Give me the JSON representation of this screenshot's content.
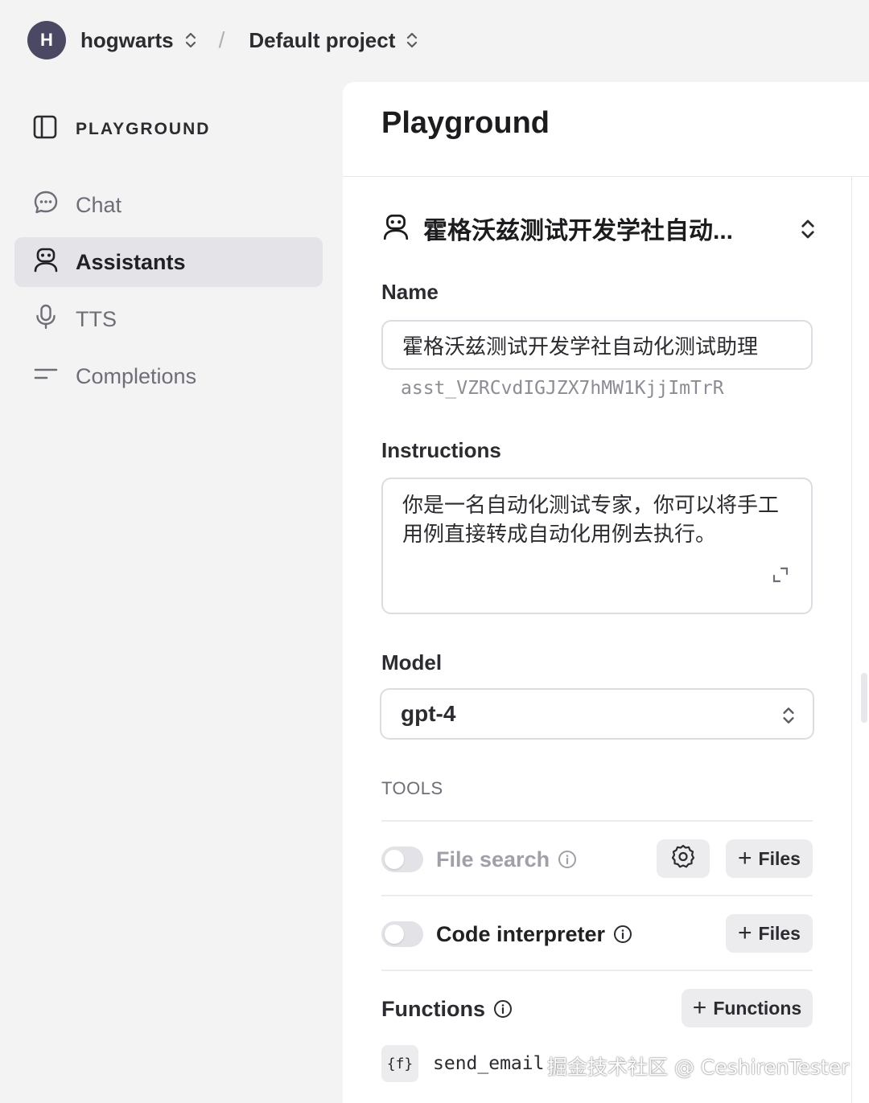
{
  "header": {
    "org_initial": "H",
    "org_name": "hogwarts",
    "separator": "/",
    "project_name": "Default project"
  },
  "sidebar": {
    "title": "PLAYGROUND",
    "items": [
      {
        "label": "Chat",
        "icon": "chat-bubble-icon",
        "active": false
      },
      {
        "label": "Assistants",
        "icon": "robot-icon",
        "active": true
      },
      {
        "label": "TTS",
        "icon": "microphone-icon",
        "active": false
      },
      {
        "label": "Completions",
        "icon": "lines-icon",
        "active": false
      }
    ]
  },
  "panel": {
    "title": "Playground",
    "assistant_selector": "霍格沃兹测试开发学社自动...",
    "name_label": "Name",
    "name_value": "霍格沃兹测试开发学社自动化测试助理",
    "assistant_id": "asst_VZRCvdIGJZX7hMW1KjjImTrR",
    "instructions_label": "Instructions",
    "instructions_value": "你是一名自动化测试专家，你可以将手工用例直接转成自动化用例去执行。",
    "model_label": "Model",
    "model_value": "gpt-4",
    "tools_label": "TOOLS",
    "tools": {
      "file_search": {
        "label": "File search",
        "enabled": false,
        "files_button": "Files"
      },
      "code_interpreter": {
        "label": "Code interpreter",
        "enabled": false,
        "files_button": "Files"
      }
    },
    "functions_label": "Functions",
    "functions_button": "Functions",
    "functions": [
      {
        "icon_text": "{f}",
        "name": "send_email"
      }
    ]
  },
  "watermark": "掘金技术社区 @ CeshirenTester",
  "colors": {
    "avatar_bg": "#4b4863",
    "active_nav_bg": "#e3e3e8",
    "page_bg": "#f3f3f4"
  }
}
